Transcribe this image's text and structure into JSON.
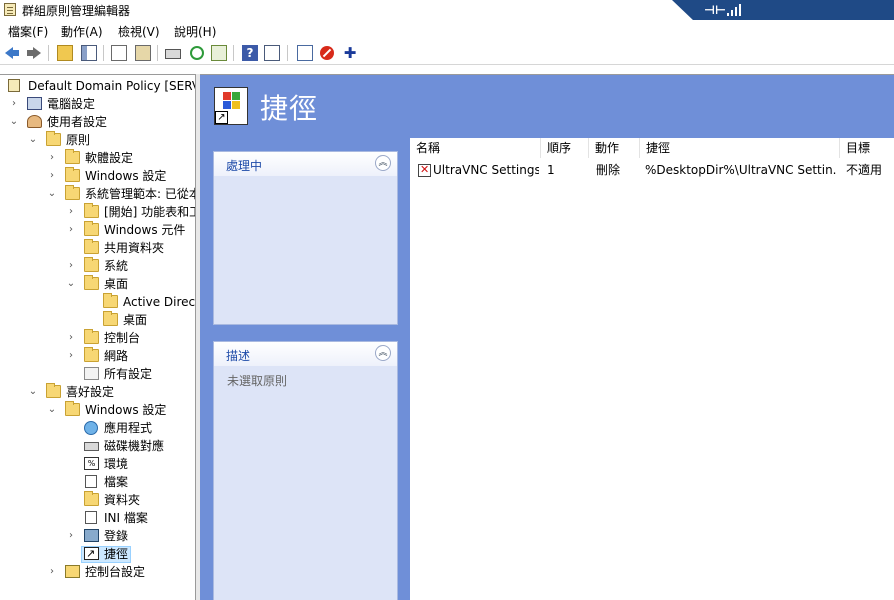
{
  "window": {
    "title": "群組原則管理編輯器"
  },
  "menu": [
    {
      "label": "檔案(F)"
    },
    {
      "label": "動作(A)"
    },
    {
      "label": "檢視(V)"
    },
    {
      "label": "說明(H)"
    }
  ],
  "tree": {
    "root": "Default Domain Policy [SERVE",
    "computer_config": "電腦設定",
    "user_config": "使用者設定",
    "policies": "原則",
    "software_settings": "軟體設定",
    "windows_settings": "Windows 設定",
    "admin_templates": "系統管理範本: 已從本",
    "start_menu": "[開始] 功能表和工",
    "windows_components": "Windows 元件",
    "shared_folders": "共用資料夾",
    "system": "系統",
    "desktop": "桌面",
    "active_directory": "Active Direct",
    "desktop_sub": "桌面",
    "control_panel": "控制台",
    "network": "網路",
    "all_settings": "所有設定",
    "preferences": "喜好設定",
    "pref_windows_settings": "Windows 設定",
    "applications": "應用程式",
    "drive_maps": "磁碟機對應",
    "environment": "環境",
    "files": "檔案",
    "folders": "資料夾",
    "ini_files": "INI 檔案",
    "registry": "登錄",
    "shortcuts": "捷徑",
    "control_panel_settings": "控制台設定"
  },
  "main": {
    "title": "捷徑",
    "processing_panel": {
      "label": "處理中"
    },
    "description_panel": {
      "label": "描述",
      "text": "未選取原則"
    },
    "columns": [
      "名稱",
      "順序",
      "動作",
      "捷徑",
      "目標"
    ],
    "rows": [
      {
        "name": "UltraVNC Settings",
        "order": "1",
        "action": "刪除",
        "shortcut": "%DesktopDir%\\UltraVNC Settin...",
        "target": "不適用"
      }
    ]
  },
  "colors": {
    "header_blue": "#6f8fd8",
    "task_panel": "#dde4f7",
    "task_head_text": "#1d4aa8",
    "remote_bar": "#1f4a86"
  }
}
